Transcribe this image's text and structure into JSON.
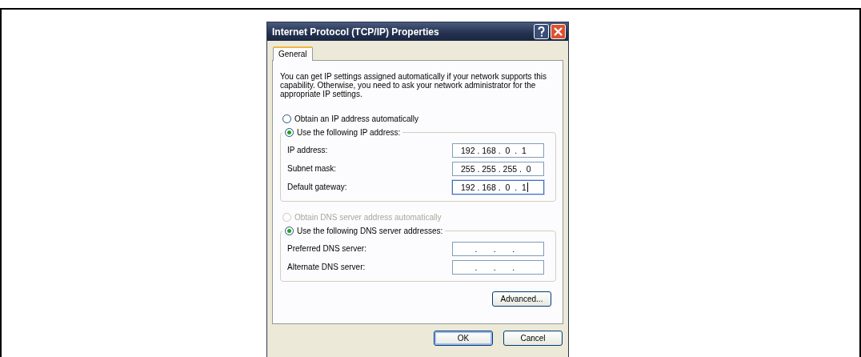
{
  "window": {
    "title": "Internet Protocol (TCP/IP) Properties"
  },
  "tabs": [
    {
      "label": "General",
      "selected": true
    }
  ],
  "description": "You can get IP settings assigned automatically if your network supports this capability. Otherwise, you need to ask your network administrator for the appropriate IP settings.",
  "ip_mode": [
    {
      "label": "Obtain an IP address automatically",
      "selected": false,
      "disabled": false
    },
    {
      "label": "Use the following IP address:",
      "selected": true,
      "disabled": false
    }
  ],
  "ip_fields": [
    {
      "label": "IP address:",
      "value": "192 . 168 .  0  .  1",
      "focused": false
    },
    {
      "label": "Subnet mask:",
      "value": "255 . 255 . 255 .  0",
      "focused": false
    },
    {
      "label": "Default gateway:",
      "value": "192 . 168 .  0  .  1",
      "focused": true
    }
  ],
  "dns_mode": [
    {
      "label": "Obtain DNS server address automatically",
      "selected": false,
      "disabled": true
    },
    {
      "label": "Use the following DNS server addresses:",
      "selected": true,
      "disabled": false
    }
  ],
  "dns_fields": [
    {
      "label": "Preferred DNS server:",
      "value": "      .       .       .",
      "focused": false
    },
    {
      "label": "Alternate DNS server:",
      "value": "      .       .       .",
      "focused": false
    }
  ],
  "advanced_button": "Advanced...",
  "buttons": [
    {
      "label": "OK",
      "default": true
    },
    {
      "label": "Cancel",
      "default": false
    }
  ]
}
